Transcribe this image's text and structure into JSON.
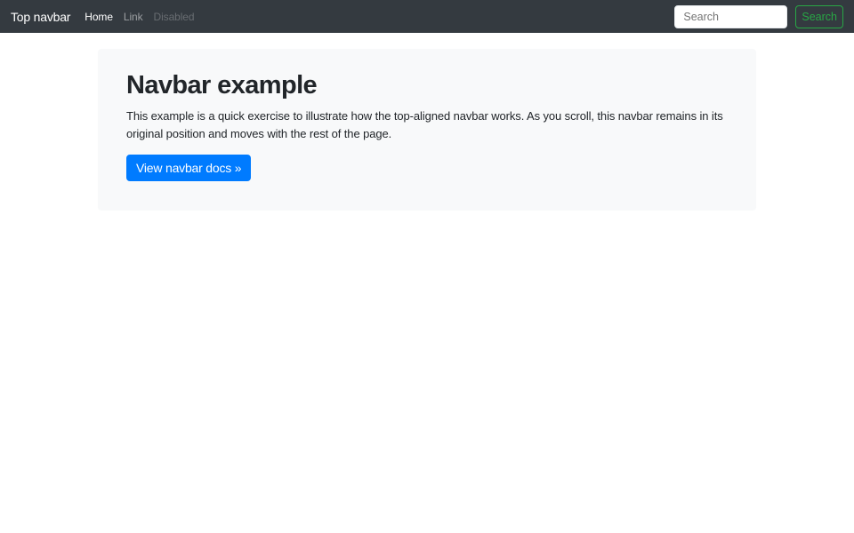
{
  "navbar": {
    "background": "#343a40",
    "brand": "Top navbar",
    "links": [
      {
        "label": "Home",
        "state": "active"
      },
      {
        "label": "Link",
        "state": "normal"
      },
      {
        "label": "Disabled",
        "state": "disabled"
      }
    ],
    "search": {
      "placeholder": "Search",
      "button_label": "Search",
      "button_color": "#28a745"
    }
  },
  "content": {
    "panel_background": "#f8f9fa",
    "title": "Navbar example",
    "description": "This example is a quick exercise to illustrate how the top-aligned navbar works. As you scroll, this navbar remains in its original position and moves with the rest of the page.",
    "cta_label": "View navbar docs »",
    "cta_color": "#007bff"
  }
}
